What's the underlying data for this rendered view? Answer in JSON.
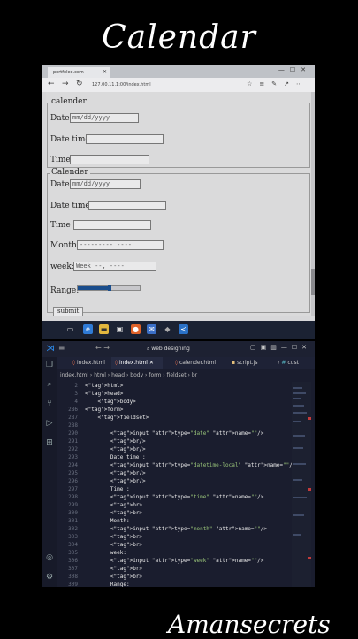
{
  "overlay": {
    "title": "Calendar",
    "watermark": "Amansecrets"
  },
  "browser": {
    "tab_title": "portfoleo.com",
    "url": "127.00.11.1:00/index.html",
    "fieldset1": {
      "legend": "calender",
      "date_label": "Date:",
      "date_value": "mm/dd/yyyy",
      "datetime_label": "Date time:",
      "time_label": "Time:"
    },
    "fieldset2": {
      "legend": "Calender",
      "date_label": "Date:",
      "date_value": "mm/dd/yyyy",
      "datetime_label": "Date time :",
      "time_label": "Time :",
      "month_label": "Month:",
      "month_value": "--------- ----",
      "week_label": "week:",
      "week_value": "Week --, ----",
      "range_label": "Range:",
      "range_value": 0.5
    },
    "submit_label": "submit"
  },
  "vscode": {
    "search": "web designing",
    "tabs": [
      "index.html",
      "index.html",
      "calender.html",
      "script.js",
      "cust"
    ],
    "breadcrumb": "index.html › html › head › body › form › fieldset › br",
    "lines": [
      {
        "n": "2",
        "t": "<html>"
      },
      {
        "n": "3",
        "t": "<head>"
      },
      {
        "n": "4",
        "t": "    <body>"
      },
      {
        "n": "286",
        "t": "<form>"
      },
      {
        "n": "287",
        "t": "    <fieldset>"
      },
      {
        "n": "288",
        "t": ""
      },
      {
        "n": "290",
        "t": "        <input type=\"date\" name=\"\"/>"
      },
      {
        "n": "291",
        "t": "        <br/>"
      },
      {
        "n": "292",
        "t": "        <br/>"
      },
      {
        "n": "293",
        "t": "        Date time :"
      },
      {
        "n": "294",
        "t": "        <input type=\"datetime-local\" name=\"\"/>"
      },
      {
        "n": "295",
        "t": "        <br/>"
      },
      {
        "n": "296",
        "t": "        <br/>"
      },
      {
        "n": "297",
        "t": "        Time :"
      },
      {
        "n": "298",
        "t": "        <input type=\"time\" name=\"\"/>"
      },
      {
        "n": "299",
        "t": "        <br>"
      },
      {
        "n": "300",
        "t": "        <br>"
      },
      {
        "n": "301",
        "t": "        Month:"
      },
      {
        "n": "302",
        "t": "        <input type=\"month\" name=\"\"/>"
      },
      {
        "n": "303",
        "t": "        <br>"
      },
      {
        "n": "304",
        "t": "        <br>"
      },
      {
        "n": "305",
        "t": "        week:"
      },
      {
        "n": "306",
        "t": "        <input type=\"week\" name=\"\"/>"
      },
      {
        "n": "307",
        "t": "        <br>"
      },
      {
        "n": "308",
        "t": "        <br>"
      },
      {
        "n": "309",
        "t": "        Range:"
      }
    ]
  }
}
